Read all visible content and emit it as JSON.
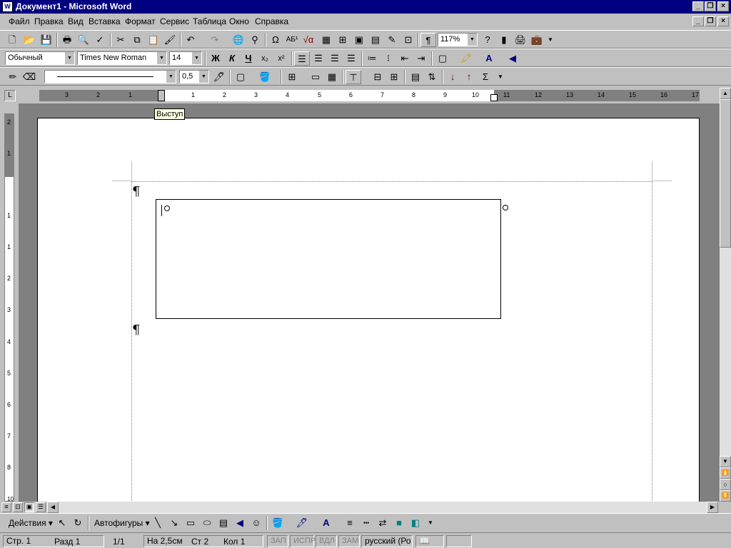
{
  "titlebar": {
    "title": "Документ1 - Microsoft Word",
    "icon": "W"
  },
  "menubar": {
    "items": [
      "Файл",
      "Правка",
      "Вид",
      "Вставка",
      "Формат",
      "Сервис",
      "Таблица",
      "Окно",
      "Справка"
    ]
  },
  "standard_toolbar": {
    "zoom": "117%"
  },
  "formatting_toolbar": {
    "style": "Обычный",
    "font": "Times New Roman",
    "size": "14"
  },
  "tables_toolbar": {
    "line_weight": "0,5"
  },
  "tooltip": {
    "text": "Выступ"
  },
  "drawing_toolbar": {
    "actions": "Действия",
    "autoshapes": "Автофигуры"
  },
  "statusbar": {
    "page": "Стр. 1",
    "section": "Разд 1",
    "pages": "1/1",
    "position": "На 2,5см",
    "line": "Ст 2",
    "column": "Кол 1",
    "rec": "ЗАП",
    "trk": "ИСПР",
    "ext": "ВДЛ",
    "ovr": "ЗАМ",
    "language": "русский (Ро"
  },
  "document": {
    "paragraph_mark": "¶"
  },
  "hruler_ticks": [
    "3",
    "2",
    "1",
    "1",
    "2",
    "3",
    "4",
    "5",
    "6",
    "7",
    "8",
    "9",
    "10",
    "11",
    "12",
    "13",
    "14",
    "15",
    "16",
    "17"
  ],
  "vruler_ticks": [
    "2",
    "1",
    "1",
    "1",
    "2",
    "3",
    "4",
    "5",
    "6",
    "7",
    "8",
    "9",
    "10"
  ]
}
